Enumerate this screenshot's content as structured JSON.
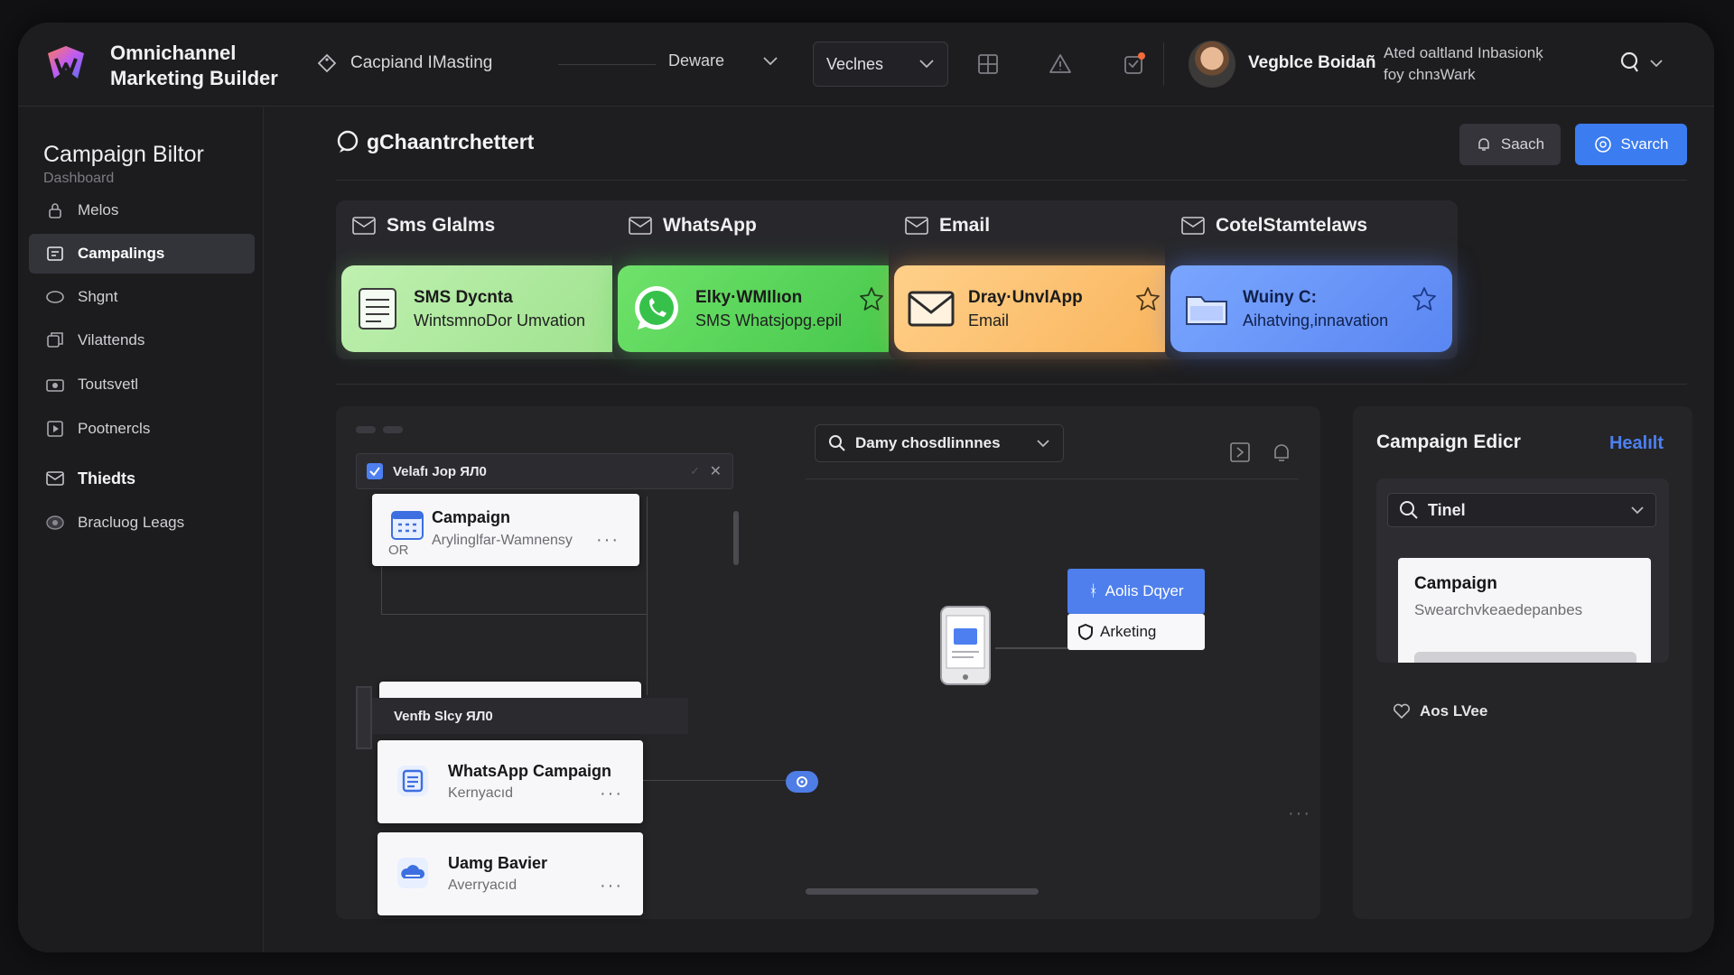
{
  "app": {
    "title": "Omnichannel\nMarketing Builder"
  },
  "topbar": {
    "crumb": "Cacpiand IMasting",
    "dropdown_plain": "Deware",
    "dropdown_box": "Veclnes",
    "user_name": "Vegblce Boidañ",
    "user_note": "Ated oaltland Inbasionķ\nfoy chnзWark"
  },
  "sidebar": {
    "title": "Campaign Biltor",
    "subtitle": "Dashboard",
    "items": [
      {
        "label": "Melos",
        "icon": "lock-icon"
      },
      {
        "label": "Campalings",
        "icon": "campaign-icon"
      },
      {
        "label": "Shgnt",
        "icon": "chat-icon"
      },
      {
        "label": "Vilattends",
        "icon": "copy-icon"
      },
      {
        "label": "Toutsvetl",
        "icon": "camera-icon"
      },
      {
        "label": "Pootnercls",
        "icon": "play-icon"
      },
      {
        "label": "Thiedts",
        "icon": "mail-icon"
      },
      {
        "label": "Bracluog Leags",
        "icon": "eye-icon"
      }
    ]
  },
  "main": {
    "title": "gChaantrchettert",
    "btn_ghost": "Saach",
    "btn_blue": "Svarch"
  },
  "channels": [
    {
      "head": "Sms Glalms",
      "title": "SMS Dycnta",
      "subtitle": "WintsmnoDor Umvation"
    },
    {
      "head": "WhatsApp",
      "title": "Elky·WMIlıon",
      "subtitle": "SMS Whatsjopg.epil"
    },
    {
      "head": "Email",
      "title": "Dray·UnvlApp",
      "subtitle": "Email"
    },
    {
      "head": "CotelStamtelaws",
      "title": "Wuiny C:",
      "subtitle": "Aihatving,innavation"
    }
  ],
  "canvas": {
    "node_head": "Velafı Jop ЯЛ0",
    "card1": {
      "title": "Campaign",
      "subtitle": "Arylinglfar-Wamnensy",
      "tag": "OR"
    },
    "group_head": "Venfb Slcy ЯЛ0",
    "card2": {
      "title": "WhatsApp Campaign",
      "subtitle": "Kernyacıd"
    },
    "card3": {
      "title": "Uamg Bavier",
      "subtitle": "Averryacıd"
    },
    "search": "Damy chosdlinnnes",
    "flow_a": "Aolis Dqyer",
    "flow_b": "Arketing"
  },
  "editor": {
    "title": "Campaign Edicr",
    "link": "Healılt",
    "search": "Tinel",
    "card_title": "Campaign",
    "card_subtitle": "Swearchvkeaedepanbes",
    "footer": "Aos LVee"
  },
  "colors": {
    "accent": "#3b7cf0",
    "sms": "#a8e69a",
    "whatsapp": "#52d057",
    "email": "#fbbf6a",
    "other": "#6a95f8"
  }
}
